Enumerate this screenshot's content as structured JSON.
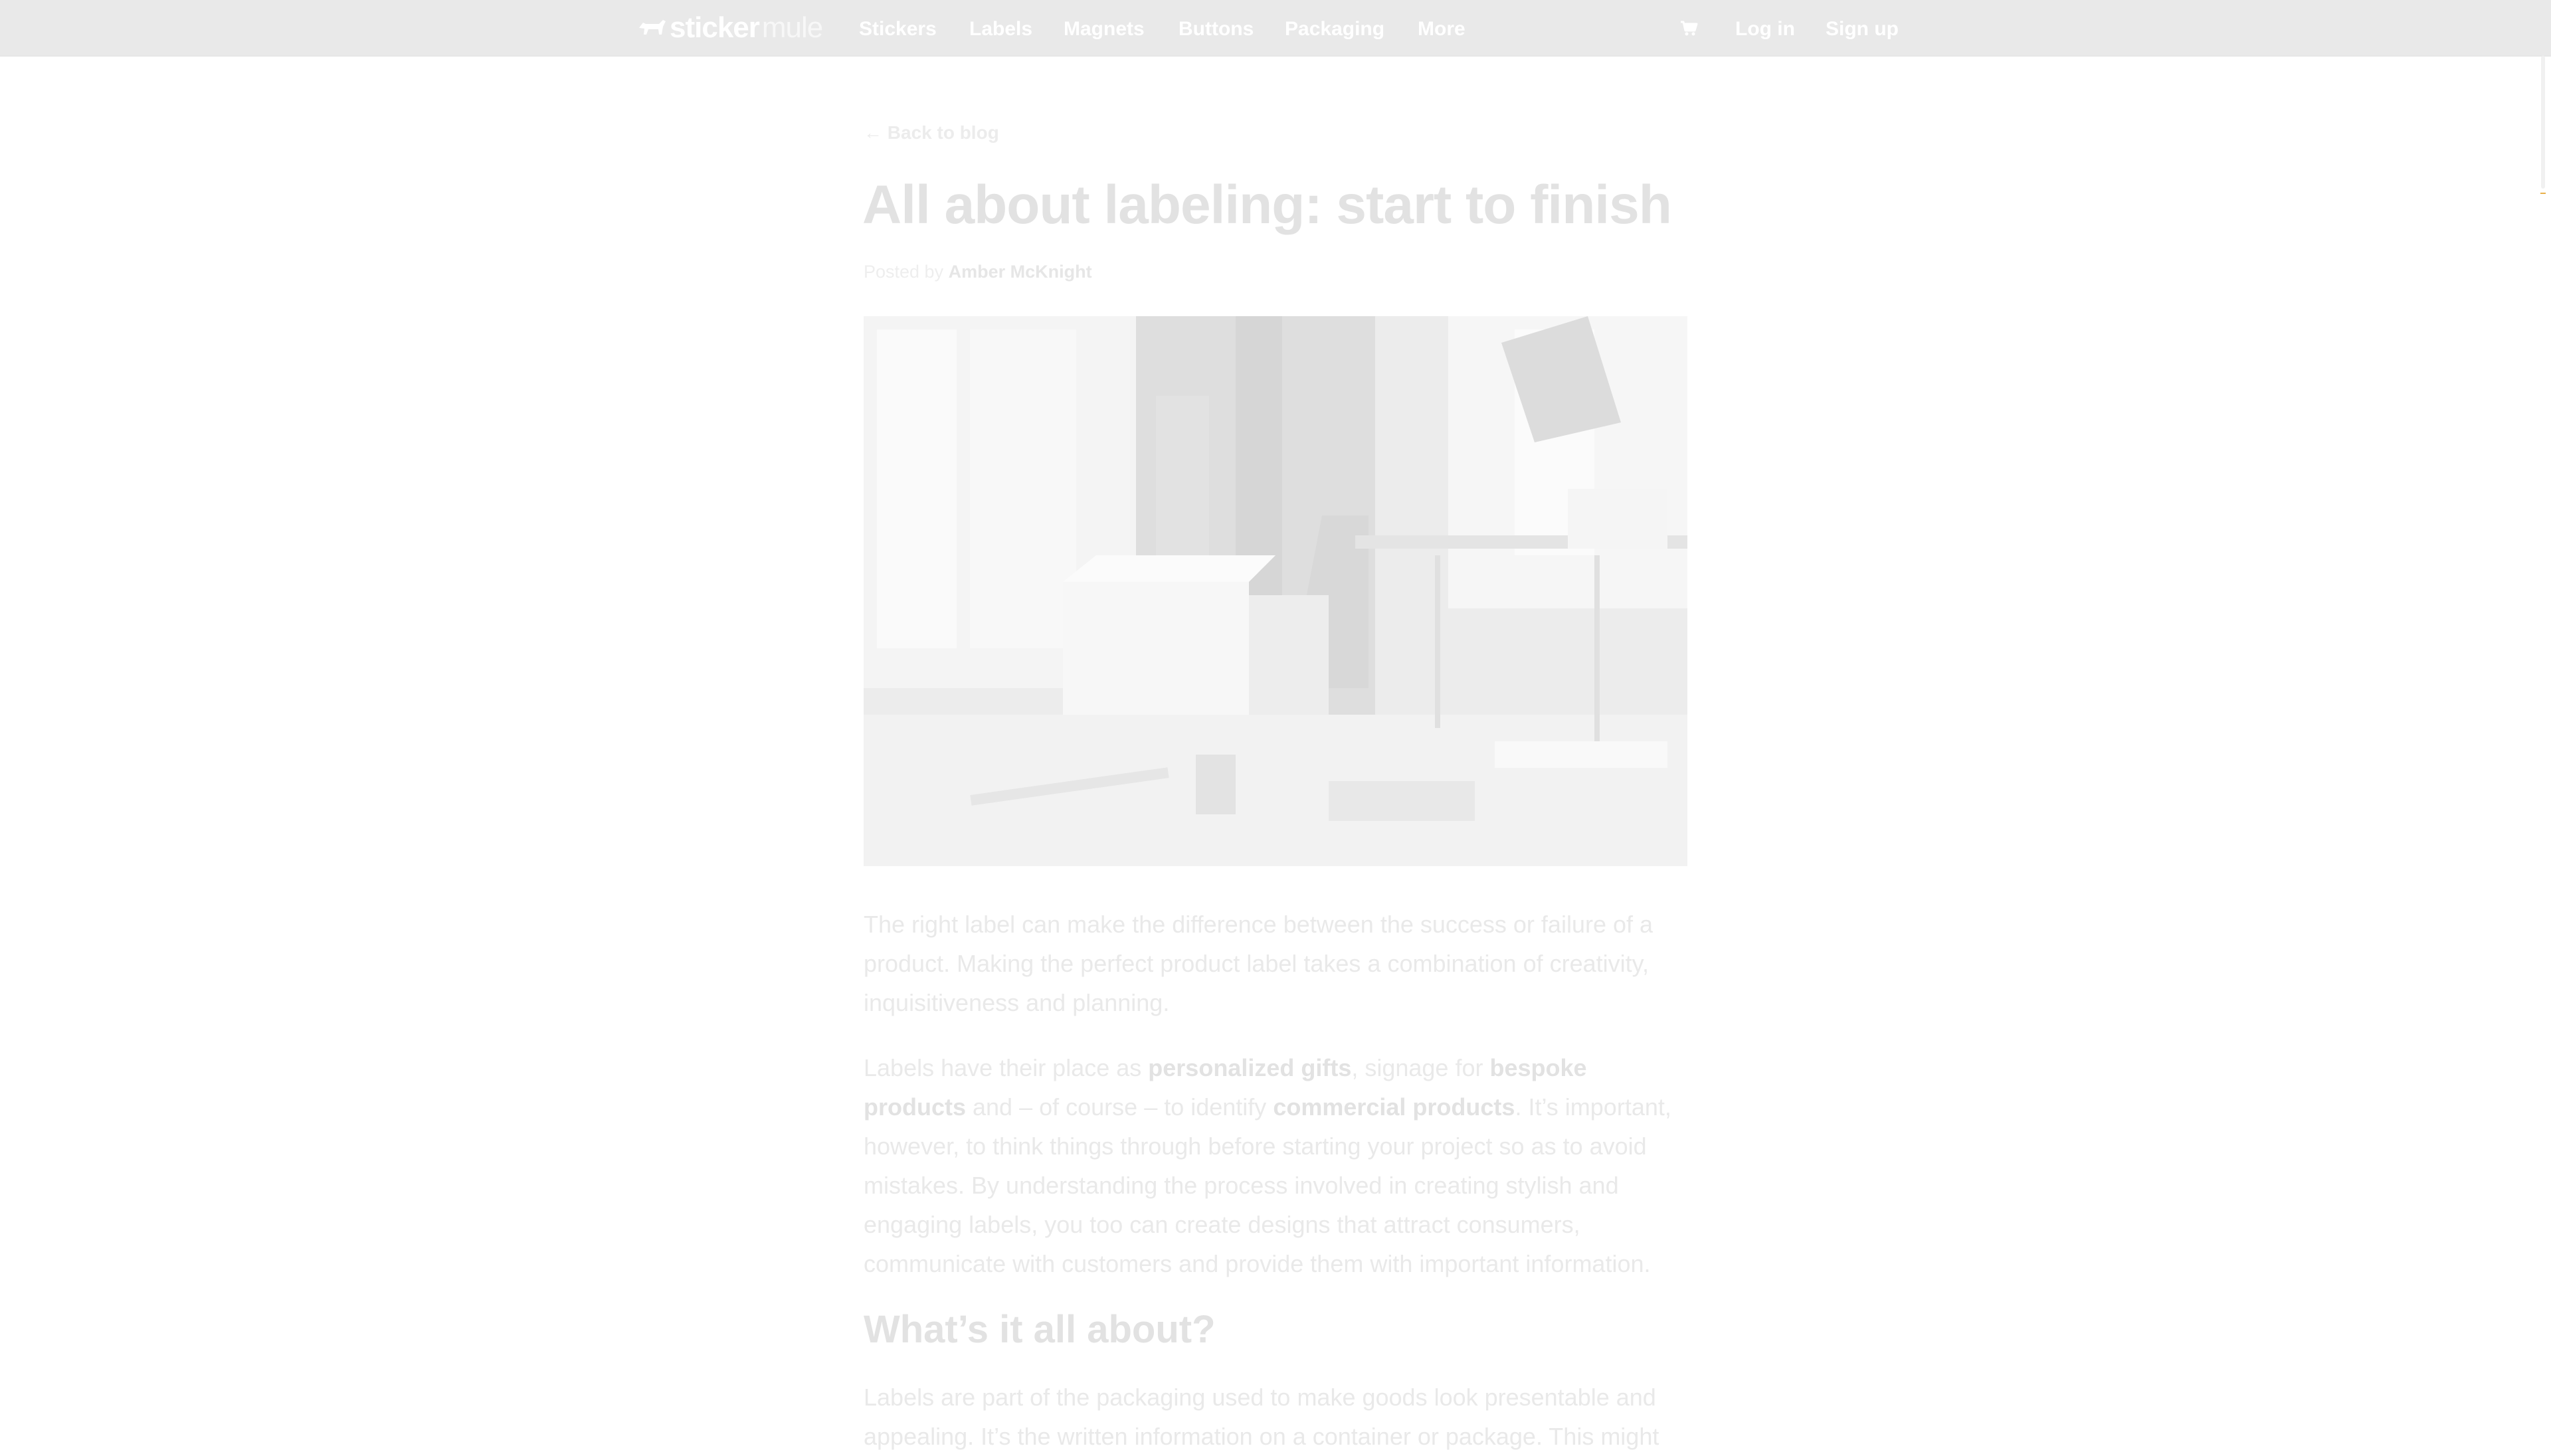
{
  "header": {
    "brand_bold": "sticker",
    "brand_light": "mule",
    "nav": [
      {
        "label": "Stickers"
      },
      {
        "label": "Labels"
      },
      {
        "label": "Magnets"
      },
      {
        "label": "Buttons"
      },
      {
        "label": "Packaging"
      },
      {
        "label": "More"
      }
    ],
    "cart_icon": "cart-icon",
    "login_label": "Log in",
    "signup_label": "Sign up"
  },
  "article": {
    "back_label": "← Back to blog",
    "title": "All about labeling: start to finish",
    "byline_prefix": "Posted by",
    "author": "Amber McKnight",
    "hero_image": "person-packing-boxes-photo",
    "p1": "The right label can make the difference between the success or failure of a product. Making the perfect product label takes a combination of creativity, inquisitiveness and planning.",
    "p2": {
      "t1": "Labels have their place as ",
      "s1": "personalized gifts",
      "t2": ", signage for ",
      "s2": "bespoke products",
      "t3": " and – of course – to identify ",
      "s3": "commercial products",
      "t4": ". It’s important, however, to think things through before starting your project so as to avoid mistakes. By understanding the process involved in creating stylish and engaging labels, you too can create designs that attract consumers, communicate with customers and provide them with important information."
    },
    "heading": "What’s it all about?",
    "p3": "Labels are part of the packaging used to make goods look presentable and appealing. It’s the written information on a container or package. This might"
  },
  "colors": {
    "topbar": "#e9e9e9",
    "nav_text": "#ffffff",
    "faded_text": "#e9e9e9",
    "scroll_marker": "#e8b04a"
  }
}
